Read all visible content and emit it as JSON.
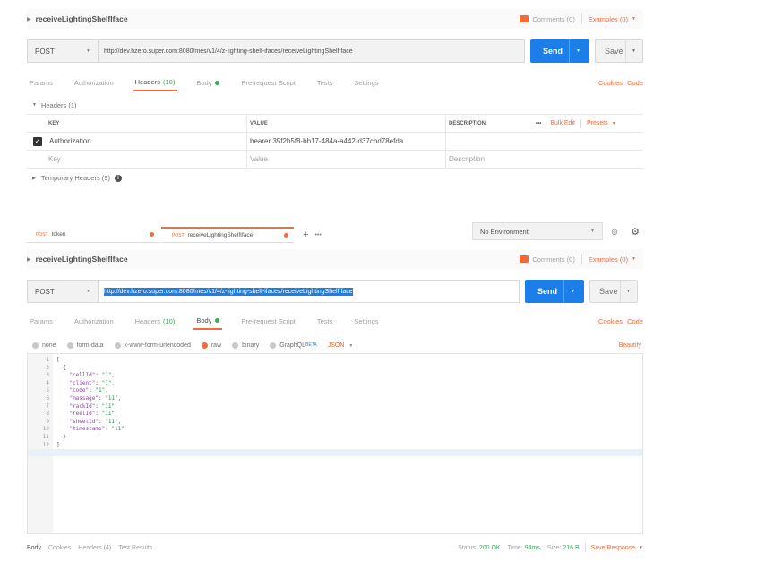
{
  "top": {
    "request_name": "receiveLightingShelfIface",
    "comments": "Comments (0)",
    "examples": "Examples (0)",
    "method": "POST",
    "url": "http://dev.hzero.super.com:8080/mes/v1/4/z-lighting-shelf-ifaces/receiveLightingShelfIface",
    "send": "Send",
    "save": "Save",
    "tabs": [
      "Params",
      "Authorization",
      "Headers",
      "Body",
      "Pre-request Script",
      "Tests",
      "Settings"
    ],
    "headers_count": "(10)",
    "cookies": "Cookies",
    "code": "Code",
    "headers_section": "Headers (1)",
    "columns": {
      "key": "KEY",
      "value": "VALUE",
      "description": "DESCRIPTION"
    },
    "more": "•••",
    "bulk_edit": "Bulk Edit",
    "presets": "Presets",
    "row": {
      "key": "Authorization",
      "value": "bearer 35f2b5f8-bb17-484a-a442-d37cbd78efda"
    },
    "placeholder": {
      "key": "Key",
      "value": "Value",
      "description": "Description"
    },
    "temporary": "Temporary Headers (9)"
  },
  "bottom": {
    "request_tabs": [
      {
        "method": "POST",
        "name": "token"
      },
      {
        "method": "POST",
        "name": "receiveLightingShelfIface"
      }
    ],
    "environment": "No Environment",
    "request_name": "receiveLightingShelfIface",
    "comments": "Comments (0)",
    "examples": "Examples (0)",
    "method": "POST",
    "url": "http://dev.hzero.super.com:8080/mes/v1/4/z-lighting-shelf-ifaces/receiveLightingShelfIface",
    "send": "Send",
    "save": "Save",
    "tabs": [
      "Params",
      "Authorization",
      "Headers",
      "Body",
      "Pre-request Script",
      "Tests",
      "Settings"
    ],
    "headers_count": "(10)",
    "cookies": "Cookies",
    "code": "Code",
    "body_types": [
      "none",
      "form-data",
      "x-www-form-urlencoded",
      "raw",
      "binary",
      "GraphQL"
    ],
    "beta": "BETA",
    "format": "JSON",
    "beautify": "Beautify",
    "code_lines": [
      {
        "n": "1",
        "t": "["
      },
      {
        "n": "2",
        "t": "  {"
      },
      {
        "n": "3",
        "k": "\"cellId\"",
        "v": "\"1\","
      },
      {
        "n": "4",
        "k": "\"client\"",
        "v": "\"1\","
      },
      {
        "n": "5",
        "k": "\"code\"",
        "v": "\"1\","
      },
      {
        "n": "6",
        "k": "\"massage\"",
        "v": "\"11\","
      },
      {
        "n": "7",
        "k": "\"rackId\"",
        "v": "\"11\","
      },
      {
        "n": "8",
        "k": "\"reelId\"",
        "v": "\"11\","
      },
      {
        "n": "9",
        "k": "\"sheetId\"",
        "v": "\"11\","
      },
      {
        "n": "10",
        "k": "\"timestamp\"",
        "v": "\"11\""
      },
      {
        "n": "11",
        "t": "  }"
      },
      {
        "n": "12",
        "t": "]"
      }
    ],
    "response_tabs": [
      "Body",
      "Cookies",
      "Headers (4)",
      "Test Results"
    ],
    "status_label": "Status:",
    "status": "200 OK",
    "time_label": "Time:",
    "time": "94ms",
    "size_label": "Size:",
    "size": "216 B",
    "save_response": "Save Response"
  },
  "colors": {
    "accent": "#f26b3a",
    "send": "#1c7ee8",
    "ok": "#3aa95b"
  }
}
